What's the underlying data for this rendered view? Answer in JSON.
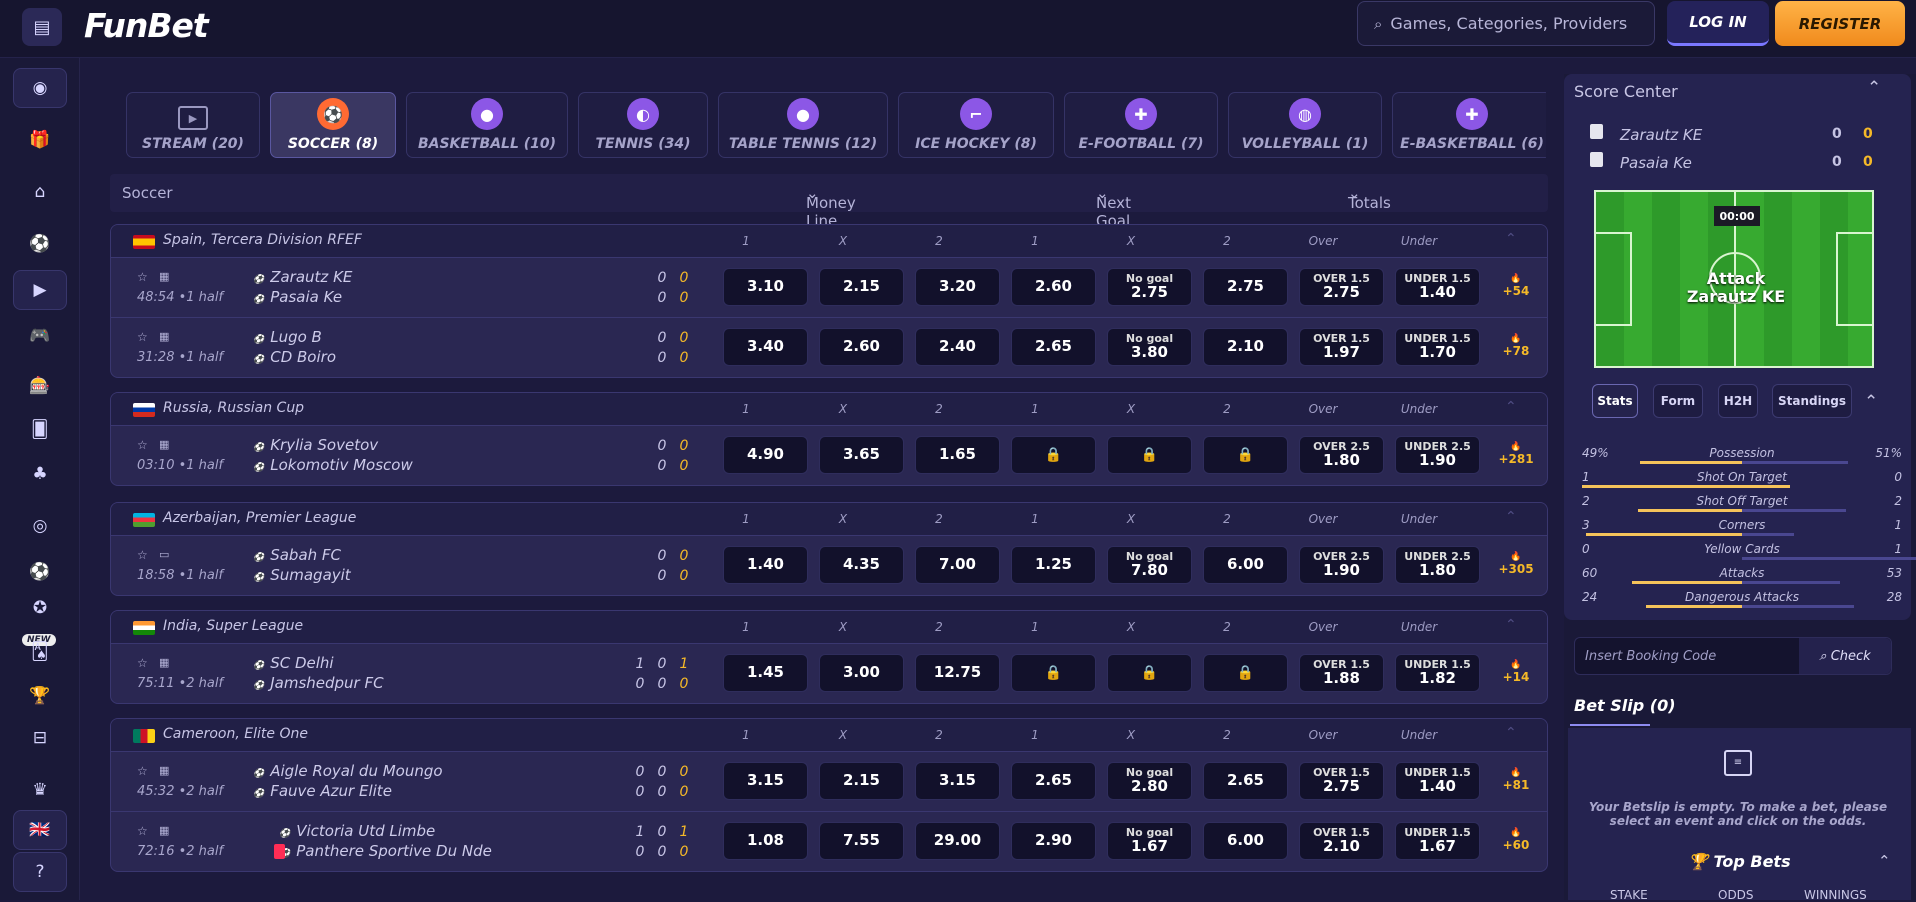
{
  "brand": "FunBet",
  "header": {
    "search_placeholder": "Games, Categories, Providers",
    "login_label": "LOG IN",
    "register_label": "REGISTER"
  },
  "sidebar": {
    "icons": [
      "egg-icon",
      "gift-icon",
      "home-icon",
      "soccer-ball-icon",
      "play-icon",
      "gamepad-icon",
      "slot-machine-icon",
      "card-icon",
      "clover-icon",
      "roulette-icon",
      "new-fire-ball-icon",
      "medal-icon",
      "cards-icon",
      "trophy-icon",
      "basket-icon",
      "crown-icon",
      "uk-flag-icon",
      "help-icon"
    ],
    "new_badge": "NEW"
  },
  "sport_tabs": [
    {
      "label": "STREAM (20)",
      "icon": "monitor-play-icon"
    },
    {
      "label": "SOCCER (8)",
      "icon": "soccer-ball-icon"
    },
    {
      "label": "BASKETBALL (10)",
      "icon": "basketball-icon"
    },
    {
      "label": "TENNIS (34)",
      "icon": "tennis-ball-icon"
    },
    {
      "label": "TABLE TENNIS (12)",
      "icon": "ping-pong-icon"
    },
    {
      "label": "ICE HOCKEY (8)",
      "icon": "hockey-stick-icon"
    },
    {
      "label": "E-FOOTBALL (7)",
      "icon": "gamepad-icon"
    },
    {
      "label": "VOLLEYBALL (1)",
      "icon": "volleyball-icon"
    },
    {
      "label": "E-BASKETBALL (6)",
      "icon": "gamepad-icon"
    }
  ],
  "columns": {
    "sport": "Soccer",
    "money_line": "Money Line",
    "next_goal": "Next Goal",
    "totals": "Totals",
    "sub": [
      "1",
      "X",
      "2",
      "1",
      "X",
      "2",
      "Over",
      "Under"
    ]
  },
  "leagues": [
    {
      "name": "Spain, Tercera Division RFEF",
      "matches": [
        {
          "time": "48:54 •1 half",
          "team1": "Zarautz KE",
          "team2": "Pasaia Ke",
          "s1": [
            "0",
            "0"
          ],
          "s2": [
            "0",
            "0"
          ],
          "odds": [
            "3.10",
            "2.15",
            "3.20",
            "2.60"
          ],
          "ng_label": "No goal",
          "ng_x": "2.75",
          "ng_2": "2.75",
          "over_label": "OVER 1.5",
          "over": "2.75",
          "under_label": "UNDER 1.5",
          "under": "1.40",
          "more": "+54"
        },
        {
          "time": "31:28 •1 half",
          "team1": "Lugo B",
          "team2": "CD Boiro",
          "s1": [
            "0",
            "0"
          ],
          "s2": [
            "0",
            "0"
          ],
          "odds": [
            "3.40",
            "2.60",
            "2.40",
            "2.65"
          ],
          "ng_label": "No goal",
          "ng_x": "3.80",
          "ng_2": "2.10",
          "over_label": "OVER 1.5",
          "over": "1.97",
          "under_label": "UNDER 1.5",
          "under": "1.70",
          "more": "+78"
        }
      ]
    },
    {
      "name": "Russia, Russian Cup",
      "matches": [
        {
          "time": "03:10 •1 half",
          "team1": "Krylia Sovetov",
          "team2": "Lokomotiv Moscow",
          "s1": [
            "0",
            "0"
          ],
          "s2": [
            "0",
            "0"
          ],
          "odds": [
            "4.90",
            "3.65",
            "1.65"
          ],
          "over_label": "OVER 2.5",
          "over": "1.80",
          "under_label": "UNDER 2.5",
          "under": "1.90",
          "more": "+281"
        }
      ]
    },
    {
      "name": "Azerbaijan, Premier League",
      "matches": [
        {
          "time": "18:58 •1 half",
          "team1": "Sabah FC",
          "team2": "Sumagayit",
          "s1": [
            "0",
            "0"
          ],
          "s2": [
            "0",
            "0"
          ],
          "odds": [
            "1.40",
            "4.35",
            "7.00",
            "1.25"
          ],
          "ng_label": "No goal",
          "ng_x": "7.80",
          "ng_2": "6.00",
          "over_label": "OVER 2.5",
          "over": "1.90",
          "under_label": "UNDER 2.5",
          "under": "1.80",
          "more": "+305"
        }
      ]
    },
    {
      "name": "India, Super League",
      "matches": [
        {
          "time": "75:11 •2 half",
          "team1": "SC Delhi",
          "team2": "Jamshedpur FC",
          "s1": [
            "1",
            "0",
            "1"
          ],
          "s2": [
            "0",
            "0",
            "0"
          ],
          "odds": [
            "1.45",
            "3.00",
            "12.75"
          ],
          "over_label": "OVER 1.5",
          "over": "1.88",
          "under_label": "UNDER 1.5",
          "under": "1.82",
          "more": "+14"
        }
      ]
    },
    {
      "name": "Cameroon, Elite One",
      "matches": [
        {
          "time": "45:32 •2 half",
          "team1": "Aigle Royal du Moungo",
          "team2": "Fauve Azur Elite",
          "s1": [
            "0",
            "0",
            "0"
          ],
          "s2": [
            "0",
            "0",
            "0"
          ],
          "odds": [
            "3.15",
            "2.15",
            "3.15",
            "2.65"
          ],
          "ng_label": "No goal",
          "ng_x": "2.80",
          "ng_2": "2.65",
          "over_label": "OVER 1.5",
          "over": "2.75",
          "under_label": "UNDER 1.5",
          "under": "1.40",
          "more": "+81"
        },
        {
          "time": "72:16 •2 half",
          "team1": "Victoria Utd Limbe",
          "team2": "Panthere Sportive Du Nde",
          "s1": [
            "1",
            "0",
            "1"
          ],
          "s2": [
            "0",
            "0",
            "0"
          ],
          "odds": [
            "1.08",
            "7.55",
            "29.00",
            "2.90"
          ],
          "ng_label": "No goal",
          "ng_x": "1.67",
          "ng_2": "6.00",
          "over_label": "OVER 1.5",
          "over": "2.10",
          "under_label": "UNDER 1.5",
          "under": "1.67",
          "more": "+60"
        }
      ]
    }
  ],
  "score_center": {
    "title": "Score Center",
    "team1": "Zarautz KE",
    "team1_score": [
      "0",
      "0"
    ],
    "team2": "Pasaia Ke",
    "team2_score": [
      "0",
      "0"
    ],
    "clock": "00:00",
    "attack_line1": "Attack",
    "attack_line2": "Zarautz KE",
    "tabs": [
      "Stats",
      "Form",
      "H2H",
      "Standings"
    ],
    "stats": [
      {
        "left": "49%",
        "name": "Possession",
        "right": "51%",
        "lv": 49,
        "rv": 51
      },
      {
        "left": "1",
        "name": "Shot On Target",
        "right": "0",
        "lv": 1,
        "rv": 0
      },
      {
        "left": "2",
        "name": "Shot Off Target",
        "right": "2",
        "lv": 2,
        "rv": 2
      },
      {
        "left": "3",
        "name": "Corners",
        "right": "1",
        "lv": 3,
        "rv": 1
      },
      {
        "left": "0",
        "name": "Yellow Cards",
        "right": "1",
        "lv": 0,
        "rv": 1
      },
      {
        "left": "60",
        "name": "Attacks",
        "right": "53",
        "lv": 60,
        "rv": 53
      },
      {
        "left": "24",
        "name": "Dangerous Attacks",
        "right": "28",
        "lv": 24,
        "rv": 28
      }
    ]
  },
  "booking": {
    "placeholder": "Insert Booking Code",
    "check": "Check"
  },
  "betslip": {
    "title": "Bet Slip (0)",
    "empty_text": "Your Betslip is empty. To make a bet, please select an event and click on the odds.",
    "top_bets": "Top Bets",
    "cols": [
      "STAKE",
      "ODDS",
      "WINNINGS"
    ]
  },
  "colors": {
    "accent": "#f5b928",
    "brand_orange": "#f08a1c",
    "bg": "#1c1a3d",
    "live_red": "#ff2d55"
  }
}
